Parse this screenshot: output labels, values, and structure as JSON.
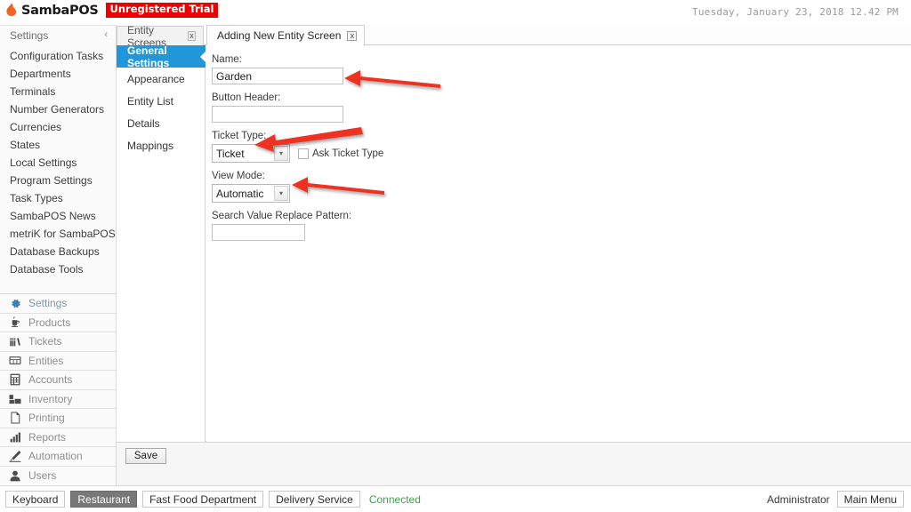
{
  "titlebar": {
    "brand": "SambaPOS",
    "brand_icon": "samba-flame-logo",
    "trial_badge": "Unregistered Trial",
    "datetime": "Tuesday, January 23, 2018 12.42 PM"
  },
  "sidebar": {
    "header": "Settings",
    "collapse_icon": "chevron-left-icon",
    "items": [
      {
        "label": "Configuration Tasks"
      },
      {
        "label": "Departments"
      },
      {
        "label": "Terminals"
      },
      {
        "label": "Number Generators"
      },
      {
        "label": "Currencies"
      },
      {
        "label": "States"
      },
      {
        "label": "Local Settings"
      },
      {
        "label": "Program Settings"
      },
      {
        "label": "Task Types"
      },
      {
        "label": "SambaPOS News"
      },
      {
        "label": "metriK for SambaPOS"
      },
      {
        "label": "Database Backups"
      },
      {
        "label": "Database Tools"
      }
    ],
    "modules": [
      {
        "label": "Settings",
        "icon": "gear-icon",
        "active": true
      },
      {
        "label": "Products",
        "icon": "cup-icon",
        "active": false
      },
      {
        "label": "Tickets",
        "icon": "books-icon",
        "active": false
      },
      {
        "label": "Entities",
        "icon": "table-icon",
        "active": false
      },
      {
        "label": "Accounts",
        "icon": "calculator-icon",
        "active": false
      },
      {
        "label": "Inventory",
        "icon": "boxes-icon",
        "active": false
      },
      {
        "label": "Printing",
        "icon": "document-icon",
        "active": false
      },
      {
        "label": "Reports",
        "icon": "bar-chart-icon",
        "active": false
      },
      {
        "label": "Automation",
        "icon": "pencil-icon",
        "active": false
      },
      {
        "label": "Users",
        "icon": "person-icon",
        "active": false
      }
    ]
  },
  "tabs": [
    {
      "label": "Entity Screens",
      "close_icon": "close-icon",
      "close_label": "x",
      "active": false
    },
    {
      "label": "Adding New Entity Screen",
      "close_icon": "close-icon",
      "close_label": "x",
      "active": true
    }
  ],
  "subnav": {
    "items": [
      {
        "label": "General Settings",
        "selected": true
      },
      {
        "label": "Appearance",
        "selected": false
      },
      {
        "label": "Entity List",
        "selected": false
      },
      {
        "label": "Details",
        "selected": false
      },
      {
        "label": "Mappings",
        "selected": false
      }
    ]
  },
  "form": {
    "name": {
      "label": "Name:",
      "value": "Garden",
      "placeholder": ""
    },
    "button_header": {
      "label": "Button Header:",
      "value": "",
      "placeholder": ""
    },
    "ticket_type": {
      "label": "Ticket Type:",
      "value": "Ticket",
      "options": [
        "Ticket"
      ],
      "dropdown_icon": "chevron-down-icon"
    },
    "ask_ticket_type": {
      "label": "Ask Ticket Type",
      "checked": false
    },
    "view_mode": {
      "label": "View Mode:",
      "value": "Automatic",
      "options": [
        "Automatic"
      ],
      "dropdown_icon": "chevron-down-icon"
    },
    "search_value_replace_pattern": {
      "label": "Search Value Replace Pattern:",
      "value": "",
      "placeholder": ""
    },
    "save_label": "Save"
  },
  "annotations": {
    "color": "#ee3124",
    "arrows": [
      {
        "name": "arrow-pointing-name-field",
        "target": "name-input"
      },
      {
        "name": "arrow-pointing-ticket-type-combo",
        "target": "tickettype-combo"
      },
      {
        "name": "arrow-pointing-view-mode-combo",
        "target": "viewmode-combo"
      }
    ]
  },
  "statusbar": {
    "buttons": [
      {
        "label": "Keyboard",
        "active": false
      },
      {
        "label": "Restaurant",
        "active": true
      },
      {
        "label": "Fast Food Department",
        "active": false
      },
      {
        "label": "Delivery Service",
        "active": false
      }
    ],
    "connection_status": "Connected",
    "connection_color": "#3f9f4a",
    "user": "Administrator",
    "main_menu_label": "Main Menu"
  },
  "colors": {
    "accent_blue": "#2196d9",
    "trial_red": "#ee0000",
    "annotation_red": "#ee3124",
    "connected_green": "#3f9f4a"
  }
}
